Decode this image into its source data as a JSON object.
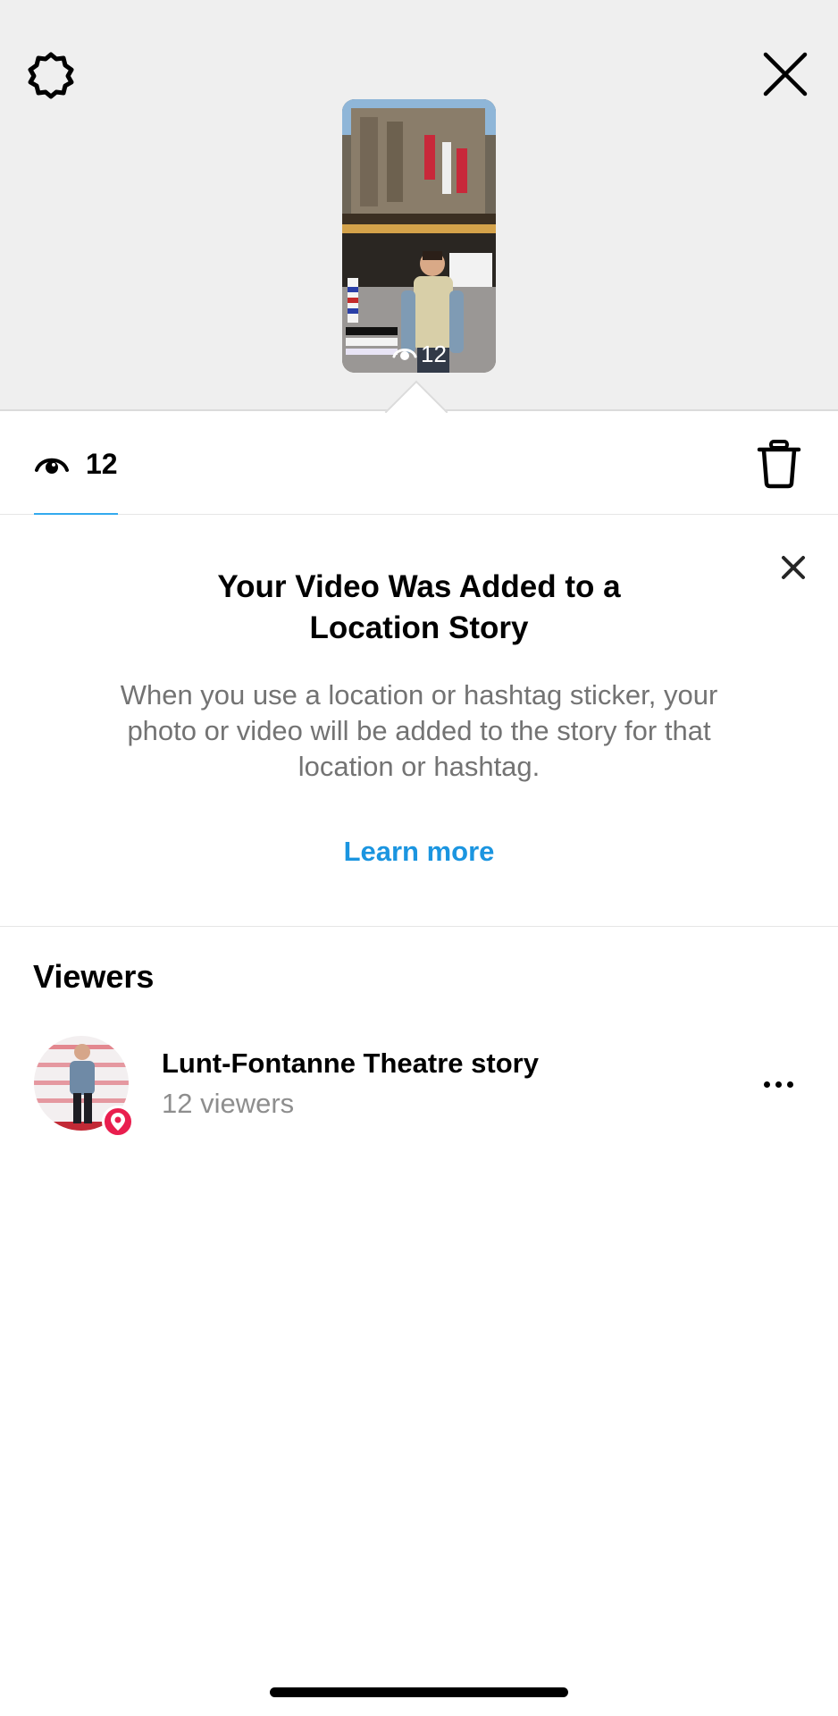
{
  "header": {
    "settings_icon": "gear-icon",
    "close_icon": "close-icon"
  },
  "story_preview": {
    "view_count": "12",
    "view_icon": "eye-icon"
  },
  "tabs": {
    "views_icon": "eye-icon",
    "views_count": "12",
    "delete_icon": "trash-icon",
    "active_tab_color": "#33aaee"
  },
  "notice": {
    "title": "Your Video Was Added to a Location Story",
    "body": "When you use a location or hashtag sticker, your photo or video will be added to the story for that location or hashtag.",
    "learn_more": "Learn more",
    "link_color": "#1b95e0",
    "close_icon": "close-icon"
  },
  "viewers": {
    "heading": "Viewers",
    "items": [
      {
        "name": "Lunt-Fontanne Theatre story",
        "subtitle": "12 viewers",
        "badge_icon": "location-pin-icon",
        "badge_color": "#e91e4e",
        "more_icon": "more-options-icon"
      }
    ]
  }
}
